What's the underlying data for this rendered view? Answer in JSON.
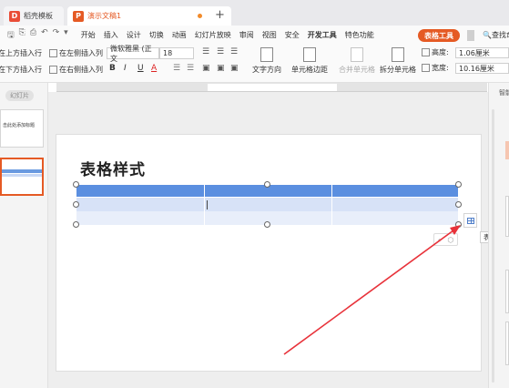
{
  "tabs": [
    {
      "label": "稻壳模板",
      "icon_glyph": "D"
    },
    {
      "label": "演示文稿1",
      "icon_glyph": "P",
      "unsaved": true
    }
  ],
  "new_tab_glyph": "+",
  "quick_access": [
    "🖫",
    "⎘",
    "⎙",
    "↶",
    "↷",
    "▾"
  ],
  "menus": [
    "开始",
    "插入",
    "设计",
    "切换",
    "动画",
    "幻灯片放映",
    "审阅",
    "视图",
    "安全",
    "开发工具",
    "特色功能"
  ],
  "active_context_tab": "表格工具",
  "search_label": "查找命",
  "ribbon": {
    "insert_above": "在上方插入行",
    "insert_below": "在下方插入行",
    "insert_left": "在左侧插入列",
    "insert_right": "在右侧插入列",
    "font_name": "微软雅黑 (正文",
    "font_size": "18",
    "bold": "B",
    "italic": "I",
    "underline": "U",
    "font_color": "A",
    "text_direction": "文字方向",
    "cell_margin": "单元格边距",
    "merge_cells": "合并单元格",
    "split_cells": "拆分单元格",
    "height_label": "高度:",
    "height_value": "1.06厘米",
    "width_label": "宽度:",
    "width_value": "10.16厘米"
  },
  "left_panel": {
    "label": "幻灯片",
    "thumb1_title": "击此处添加标题"
  },
  "slide": {
    "title": "表格样式"
  },
  "tooltip": "表格样式",
  "right_panel_label": "智能",
  "colors": {
    "accent": "#e55a24",
    "table_header": "#5b8fe0",
    "table_band": "#d7e2f7",
    "arrow": "#e8323a"
  }
}
